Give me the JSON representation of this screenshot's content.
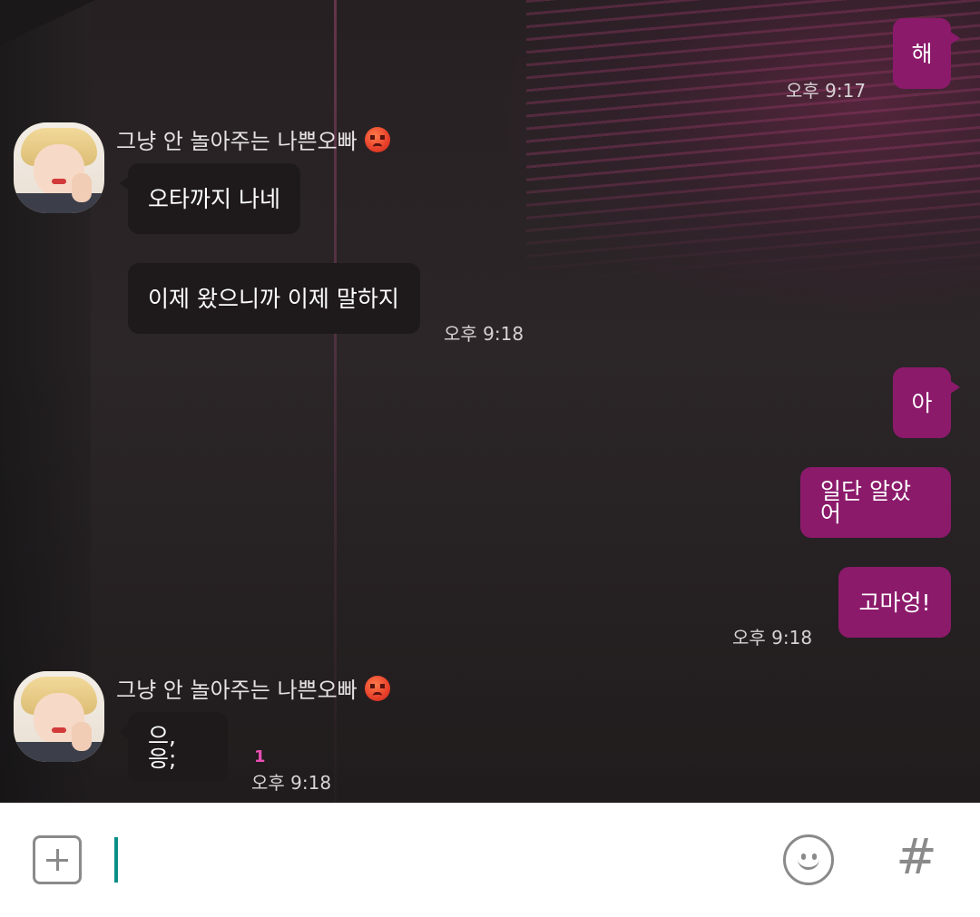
{
  "chat": {
    "sender_name": "그냥 안 놀아주는 나쁜오빠",
    "messages_out_1": {
      "text": "해",
      "time": "오후 9:17"
    },
    "messages_in_1": {
      "line1": "오타까지 나네",
      "line2": "이제 왔으니까 이제 말하지",
      "time": "오후 9:18"
    },
    "messages_out_2": {
      "line1": "아",
      "line2": "일단 알았어",
      "line3": "고마엉!",
      "time": "오후 9:18"
    },
    "messages_in_2": {
      "line1": "으, 응;",
      "unread_count": "1",
      "time": "오후 9:18"
    }
  },
  "input_bar": {
    "message_value": "",
    "add_icon": "plus-square-icon",
    "emoji_icon": "smiley-icon",
    "hashtag_icon": "hash-icon",
    "hashtag_glyph": "#"
  },
  "colors": {
    "outgoing_bubble": "#8b1a6b",
    "incoming_bubble": "#1e1a1c",
    "unread_count": "#e94fb3",
    "caret": "#0a8f86"
  }
}
